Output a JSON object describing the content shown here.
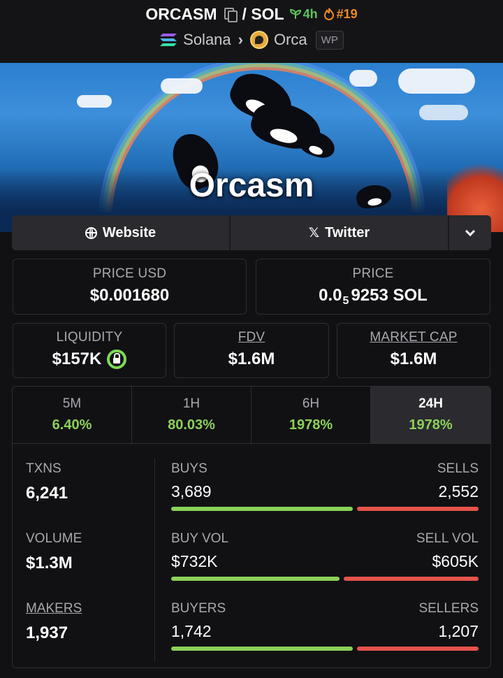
{
  "header": {
    "symbol": "ORCASM",
    "quote": "/ SOL",
    "age": "4h",
    "rank": "#19",
    "chain": "Solana",
    "dex": "Orca",
    "badge": "WP"
  },
  "banner": {
    "title": "Orcasm"
  },
  "links": {
    "website": "Website",
    "twitter": "Twitter",
    "twitter_icon": "x-icon"
  },
  "prices": {
    "price_usd_label": "PRICE USD",
    "price_usd": "$0.001680",
    "price_label": "PRICE",
    "price_sol_prefix": "0.0",
    "price_sol_sub": "5",
    "price_sol_rest": "9253 SOL"
  },
  "stats": {
    "liquidity_label": "LIQUIDITY",
    "liquidity": "$157K",
    "fdv_label": "FDV",
    "fdv": "$1.6M",
    "mcap_label": "MARKET CAP",
    "mcap": "$1.6M"
  },
  "tabs": [
    {
      "label": "5M",
      "value": "6.40%"
    },
    {
      "label": "1H",
      "value": "80.03%"
    },
    {
      "label": "6H",
      "value": "1978%"
    },
    {
      "label": "24H",
      "value": "1978%",
      "active": true
    }
  ],
  "metrics": {
    "txns_label": "TXNS",
    "txns": "6,241",
    "buys_label": "BUYS",
    "buys": "3,689",
    "sells_label": "SELLS",
    "sells": "2,552",
    "buys_share": 0.591,
    "volume_label": "VOLUME",
    "volume": "$1.3M",
    "buy_vol_label": "BUY VOL",
    "buy_vol": "$732K",
    "sell_vol_label": "SELL VOL",
    "sell_vol": "$605K",
    "buy_vol_share": 0.547,
    "makers_label": "MAKERS",
    "makers": "1,937",
    "buyers_label": "BUYERS",
    "buyers": "1,742",
    "sellers_label": "SELLERS",
    "sellers": "1,207",
    "buyers_share": 0.591
  },
  "colors": {
    "positive": "#8cd15a",
    "negative": "#e5534b",
    "background": "#111114",
    "panel": "#2a2a2f"
  }
}
